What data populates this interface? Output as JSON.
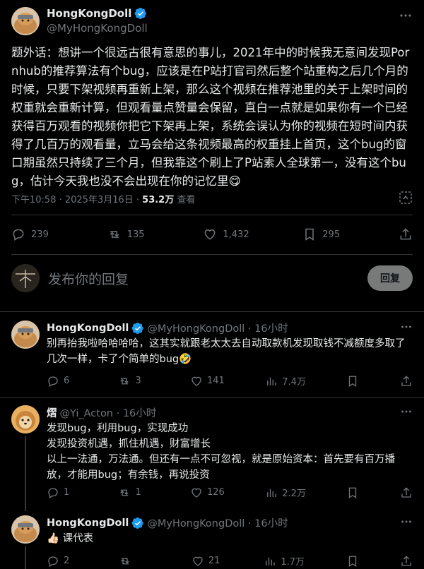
{
  "main_tweet": {
    "display_name": "HongKongDoll",
    "handle": "@MyHongKongDoll",
    "text": "题外话：想讲一个很远古很有意思的事儿，2021年中的时候我无意间发现Pornhub的推荐算法有个bug，应该是在P站打官司然后整个站重构之后几个月的时候，只要下架视频再重新上架，那么这个视频在推荐池里的关于上架时间的权重就会重新计算，但观看量点赞量会保留，直白一点就是如果你有一个已经获得百万观看的视频你把它下架再上架，系统会误认为你的视频在短时间内获得了几百万的观看量，立马会给这条视频最高的权重挂上首页，这个bug的窗口期虽然只持续了三个月，但我靠这个刷上了P站素人全球第一，没有这个bug，估计今天我也没不会出现在你的记忆里😋",
    "timestamp": "下午10:58 · 2025年3月16日 · ",
    "views": "53.2万",
    "views_label": " 查看",
    "stats": {
      "replies": "239",
      "retweets": "135",
      "likes": "1,432",
      "bookmarks": "295"
    }
  },
  "reply_box": {
    "placeholder": "发布你的回复",
    "button": "回复"
  },
  "replies": [
    {
      "display_name": "HongKongDoll",
      "handle": "@MyHongKongDoll · 16小时",
      "verified": true,
      "text": "别再抬我啦哈哈哈哈，这其实就跟老太太去自动取款机发现取钱不减额度多取了几次一样，卡了个简单的bug🤣",
      "stats": {
        "replies": "6",
        "retweets": "3",
        "likes": "141",
        "views": "7.4万"
      }
    },
    {
      "display_name": "熠",
      "handle": "@Yi_Acton · 16小时",
      "verified": false,
      "text": "发现bug，利用bug，实现成功\n发现投资机遇，抓住机遇，财富增长\n以上一法通，万法通。但还有一点不可忽视，就是原始资本：首先要有百万播放，才能用bug；有余钱，再说投资",
      "stats": {
        "replies": "1",
        "retweets": "1",
        "likes": "126",
        "views": "2.2万"
      }
    },
    {
      "display_name": "HongKongDoll",
      "handle": "@MyHongKongDoll · 16小时",
      "verified": true,
      "text": "👍🏻 课代表",
      "stats": {
        "replies": "2",
        "retweets": "",
        "likes": "21",
        "views": "1.7万"
      }
    }
  ],
  "colors": {
    "background": "#000000",
    "text": "#e7e9ea",
    "muted": "#71767b",
    "verified": "#1d9bf0",
    "border": "#2f3336"
  }
}
